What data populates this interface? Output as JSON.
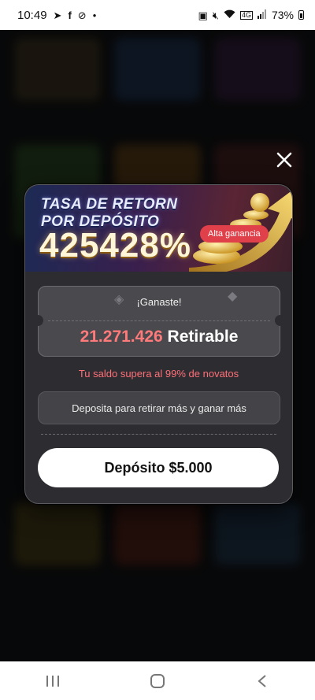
{
  "status_bar": {
    "time": "10:49",
    "battery": "73%",
    "left_icons": [
      "telegram-icon",
      "facebook-icon",
      "do-not-disturb-icon",
      "dot-icon"
    ],
    "right_icons": [
      "lock-icon",
      "mute-icon",
      "wifi-icon",
      "volte-icon",
      "signal-icon",
      "battery-icon"
    ]
  },
  "modal": {
    "banner": {
      "line1": "TASA DE RETORN",
      "line2": "POR DEPÓSITO",
      "percentage": "425428%",
      "badge": "Alta ganancia"
    },
    "ticket": {
      "won_label": "¡Ganaste!",
      "amount": "21.271.426",
      "amount_suffix": "Retirable"
    },
    "note": "Tu saldo supera al 99% de novatos",
    "deposit_more_label": "Deposita para retirar más y ganar más",
    "deposit_button_label": "Depósito $5.000",
    "close_icon": "close-icon"
  },
  "navbar": {
    "icons": [
      "recent-apps-icon",
      "home-icon",
      "back-icon"
    ]
  },
  "colors": {
    "accent_red": "#ff6f78",
    "badge_red": "#e0404a",
    "modal_bg": "#2d2d31"
  }
}
